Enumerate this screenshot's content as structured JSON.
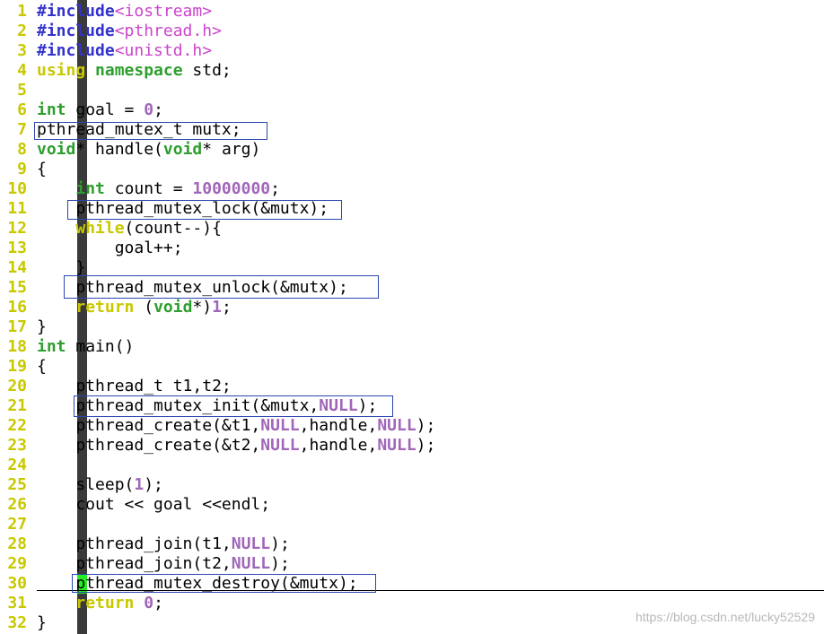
{
  "editor": {
    "lines": [
      {
        "n": "1",
        "tokens": [
          [
            "pre",
            "#include"
          ],
          [
            "str",
            "<iostream>"
          ]
        ]
      },
      {
        "n": "2",
        "tokens": [
          [
            "pre",
            "#include"
          ],
          [
            "str",
            "<pthread.h>"
          ]
        ]
      },
      {
        "n": "3",
        "tokens": [
          [
            "pre",
            "#include"
          ],
          [
            "str",
            "<unistd.h>"
          ]
        ]
      },
      {
        "n": "4",
        "tokens": [
          [
            "ctl",
            "using"
          ],
          [
            "plain",
            " "
          ],
          [
            "kw",
            "namespace"
          ],
          [
            "plain",
            " std;"
          ]
        ]
      },
      {
        "n": "5",
        "tokens": []
      },
      {
        "n": "6",
        "tokens": [
          [
            "kw",
            "int"
          ],
          [
            "plain",
            " goal = "
          ],
          [
            "num",
            "0"
          ],
          [
            "plain",
            ";"
          ]
        ]
      },
      {
        "n": "7",
        "tokens": [
          [
            "plain",
            "pthread_mutex_t mutx;"
          ]
        ]
      },
      {
        "n": "8",
        "tokens": [
          [
            "kw",
            "void"
          ],
          [
            "plain",
            "* handle("
          ],
          [
            "kw",
            "void"
          ],
          [
            "plain",
            "* arg)"
          ]
        ]
      },
      {
        "n": "9",
        "tokens": [
          [
            "plain",
            "{"
          ]
        ]
      },
      {
        "n": "10",
        "tokens": [
          [
            "plain",
            "    "
          ],
          [
            "kw",
            "int"
          ],
          [
            "plain",
            " count = "
          ],
          [
            "num",
            "10000000"
          ],
          [
            "plain",
            ";"
          ]
        ]
      },
      {
        "n": "11",
        "tokens": [
          [
            "plain",
            "    pthread_mutex_lock(&mutx);"
          ]
        ]
      },
      {
        "n": "12",
        "tokens": [
          [
            "plain",
            "    "
          ],
          [
            "ctl",
            "while"
          ],
          [
            "plain",
            "(count--){"
          ]
        ]
      },
      {
        "n": "13",
        "tokens": [
          [
            "plain",
            "        goal++;"
          ]
        ]
      },
      {
        "n": "14",
        "tokens": [
          [
            "plain",
            "    }"
          ]
        ]
      },
      {
        "n": "15",
        "tokens": [
          [
            "plain",
            "    pthread_mutex_unlock(&mutx);"
          ]
        ]
      },
      {
        "n": "16",
        "tokens": [
          [
            "plain",
            "    "
          ],
          [
            "ctl",
            "return"
          ],
          [
            "plain",
            " ("
          ],
          [
            "kw",
            "void"
          ],
          [
            "plain",
            "*)"
          ],
          [
            "num",
            "1"
          ],
          [
            "plain",
            ";"
          ]
        ]
      },
      {
        "n": "17",
        "tokens": [
          [
            "plain",
            "}"
          ]
        ]
      },
      {
        "n": "18",
        "tokens": [
          [
            "kw",
            "int"
          ],
          [
            "plain",
            " main()"
          ]
        ]
      },
      {
        "n": "19",
        "tokens": [
          [
            "plain",
            "{"
          ]
        ]
      },
      {
        "n": "20",
        "tokens": [
          [
            "plain",
            "    pthread_t t1,t2;"
          ]
        ]
      },
      {
        "n": "21",
        "tokens": [
          [
            "plain",
            "    pthread_mutex_init(&mutx,"
          ],
          [
            "const",
            "NULL"
          ],
          [
            "plain",
            ");"
          ]
        ]
      },
      {
        "n": "22",
        "tokens": [
          [
            "plain",
            "    pthread_create(&t1,"
          ],
          [
            "const",
            "NULL"
          ],
          [
            "plain",
            ",handle,"
          ],
          [
            "const",
            "NULL"
          ],
          [
            "plain",
            ");"
          ]
        ]
      },
      {
        "n": "23",
        "tokens": [
          [
            "plain",
            "    pthread_create(&t2,"
          ],
          [
            "const",
            "NULL"
          ],
          [
            "plain",
            ",handle,"
          ],
          [
            "const",
            "NULL"
          ],
          [
            "plain",
            ");"
          ]
        ]
      },
      {
        "n": "24",
        "tokens": []
      },
      {
        "n": "25",
        "tokens": [
          [
            "plain",
            "    sleep("
          ],
          [
            "num",
            "1"
          ],
          [
            "plain",
            ");"
          ]
        ]
      },
      {
        "n": "26",
        "tokens": [
          [
            "plain",
            "    cout << goal <<endl;"
          ]
        ]
      },
      {
        "n": "27",
        "tokens": []
      },
      {
        "n": "28",
        "tokens": [
          [
            "plain",
            "    pthread_join(t1,"
          ],
          [
            "const",
            "NULL"
          ],
          [
            "plain",
            ");"
          ]
        ]
      },
      {
        "n": "29",
        "tokens": [
          [
            "plain",
            "    pthread_join(t2,"
          ],
          [
            "const",
            "NULL"
          ],
          [
            "plain",
            ");"
          ]
        ]
      },
      {
        "n": "30",
        "tokens": [
          [
            "plain",
            "    pthread_mutex_destroy(&mutx);"
          ]
        ]
      },
      {
        "n": "31",
        "tokens": [
          [
            "plain",
            "    "
          ],
          [
            "ctl",
            "return"
          ],
          [
            "plain",
            " "
          ],
          [
            "num",
            "0"
          ],
          [
            "plain",
            ";"
          ]
        ]
      },
      {
        "n": "32",
        "tokens": [
          [
            "plain",
            "}"
          ]
        ]
      }
    ]
  },
  "watermark": "https://blog.csdn.net/lucky52529",
  "colors": {
    "line_number": "#c8c800",
    "preprocessor": "#3333cc",
    "string": "#cc44cc",
    "type_keyword": "#2e9e2e",
    "control_keyword": "#c8c800",
    "number": "#a066b8",
    "highlight_box": "#2b45b0",
    "cursor": "#22ee22"
  }
}
